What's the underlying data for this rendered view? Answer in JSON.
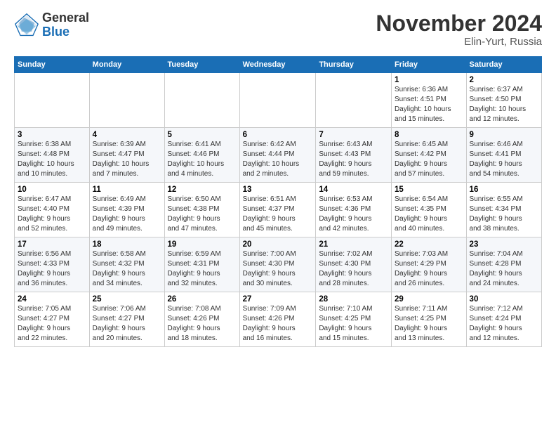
{
  "logo": {
    "general": "General",
    "blue": "Blue"
  },
  "title": "November 2024",
  "location": "Elin-Yurt, Russia",
  "headers": [
    "Sunday",
    "Monday",
    "Tuesday",
    "Wednesday",
    "Thursday",
    "Friday",
    "Saturday"
  ],
  "weeks": [
    [
      {
        "day": "",
        "info": ""
      },
      {
        "day": "",
        "info": ""
      },
      {
        "day": "",
        "info": ""
      },
      {
        "day": "",
        "info": ""
      },
      {
        "day": "",
        "info": ""
      },
      {
        "day": "1",
        "info": "Sunrise: 6:36 AM\nSunset: 4:51 PM\nDaylight: 10 hours\nand 15 minutes."
      },
      {
        "day": "2",
        "info": "Sunrise: 6:37 AM\nSunset: 4:50 PM\nDaylight: 10 hours\nand 12 minutes."
      }
    ],
    [
      {
        "day": "3",
        "info": "Sunrise: 6:38 AM\nSunset: 4:48 PM\nDaylight: 10 hours\nand 10 minutes."
      },
      {
        "day": "4",
        "info": "Sunrise: 6:39 AM\nSunset: 4:47 PM\nDaylight: 10 hours\nand 7 minutes."
      },
      {
        "day": "5",
        "info": "Sunrise: 6:41 AM\nSunset: 4:46 PM\nDaylight: 10 hours\nand 4 minutes."
      },
      {
        "day": "6",
        "info": "Sunrise: 6:42 AM\nSunset: 4:44 PM\nDaylight: 10 hours\nand 2 minutes."
      },
      {
        "day": "7",
        "info": "Sunrise: 6:43 AM\nSunset: 4:43 PM\nDaylight: 9 hours\nand 59 minutes."
      },
      {
        "day": "8",
        "info": "Sunrise: 6:45 AM\nSunset: 4:42 PM\nDaylight: 9 hours\nand 57 minutes."
      },
      {
        "day": "9",
        "info": "Sunrise: 6:46 AM\nSunset: 4:41 PM\nDaylight: 9 hours\nand 54 minutes."
      }
    ],
    [
      {
        "day": "10",
        "info": "Sunrise: 6:47 AM\nSunset: 4:40 PM\nDaylight: 9 hours\nand 52 minutes."
      },
      {
        "day": "11",
        "info": "Sunrise: 6:49 AM\nSunset: 4:39 PM\nDaylight: 9 hours\nand 49 minutes."
      },
      {
        "day": "12",
        "info": "Sunrise: 6:50 AM\nSunset: 4:38 PM\nDaylight: 9 hours\nand 47 minutes."
      },
      {
        "day": "13",
        "info": "Sunrise: 6:51 AM\nSunset: 4:37 PM\nDaylight: 9 hours\nand 45 minutes."
      },
      {
        "day": "14",
        "info": "Sunrise: 6:53 AM\nSunset: 4:36 PM\nDaylight: 9 hours\nand 42 minutes."
      },
      {
        "day": "15",
        "info": "Sunrise: 6:54 AM\nSunset: 4:35 PM\nDaylight: 9 hours\nand 40 minutes."
      },
      {
        "day": "16",
        "info": "Sunrise: 6:55 AM\nSunset: 4:34 PM\nDaylight: 9 hours\nand 38 minutes."
      }
    ],
    [
      {
        "day": "17",
        "info": "Sunrise: 6:56 AM\nSunset: 4:33 PM\nDaylight: 9 hours\nand 36 minutes."
      },
      {
        "day": "18",
        "info": "Sunrise: 6:58 AM\nSunset: 4:32 PM\nDaylight: 9 hours\nand 34 minutes."
      },
      {
        "day": "19",
        "info": "Sunrise: 6:59 AM\nSunset: 4:31 PM\nDaylight: 9 hours\nand 32 minutes."
      },
      {
        "day": "20",
        "info": "Sunrise: 7:00 AM\nSunset: 4:30 PM\nDaylight: 9 hours\nand 30 minutes."
      },
      {
        "day": "21",
        "info": "Sunrise: 7:02 AM\nSunset: 4:30 PM\nDaylight: 9 hours\nand 28 minutes."
      },
      {
        "day": "22",
        "info": "Sunrise: 7:03 AM\nSunset: 4:29 PM\nDaylight: 9 hours\nand 26 minutes."
      },
      {
        "day": "23",
        "info": "Sunrise: 7:04 AM\nSunset: 4:28 PM\nDaylight: 9 hours\nand 24 minutes."
      }
    ],
    [
      {
        "day": "24",
        "info": "Sunrise: 7:05 AM\nSunset: 4:27 PM\nDaylight: 9 hours\nand 22 minutes."
      },
      {
        "day": "25",
        "info": "Sunrise: 7:06 AM\nSunset: 4:27 PM\nDaylight: 9 hours\nand 20 minutes."
      },
      {
        "day": "26",
        "info": "Sunrise: 7:08 AM\nSunset: 4:26 PM\nDaylight: 9 hours\nand 18 minutes."
      },
      {
        "day": "27",
        "info": "Sunrise: 7:09 AM\nSunset: 4:26 PM\nDaylight: 9 hours\nand 16 minutes."
      },
      {
        "day": "28",
        "info": "Sunrise: 7:10 AM\nSunset: 4:25 PM\nDaylight: 9 hours\nand 15 minutes."
      },
      {
        "day": "29",
        "info": "Sunrise: 7:11 AM\nSunset: 4:25 PM\nDaylight: 9 hours\nand 13 minutes."
      },
      {
        "day": "30",
        "info": "Sunrise: 7:12 AM\nSunset: 4:24 PM\nDaylight: 9 hours\nand 12 minutes."
      }
    ]
  ]
}
